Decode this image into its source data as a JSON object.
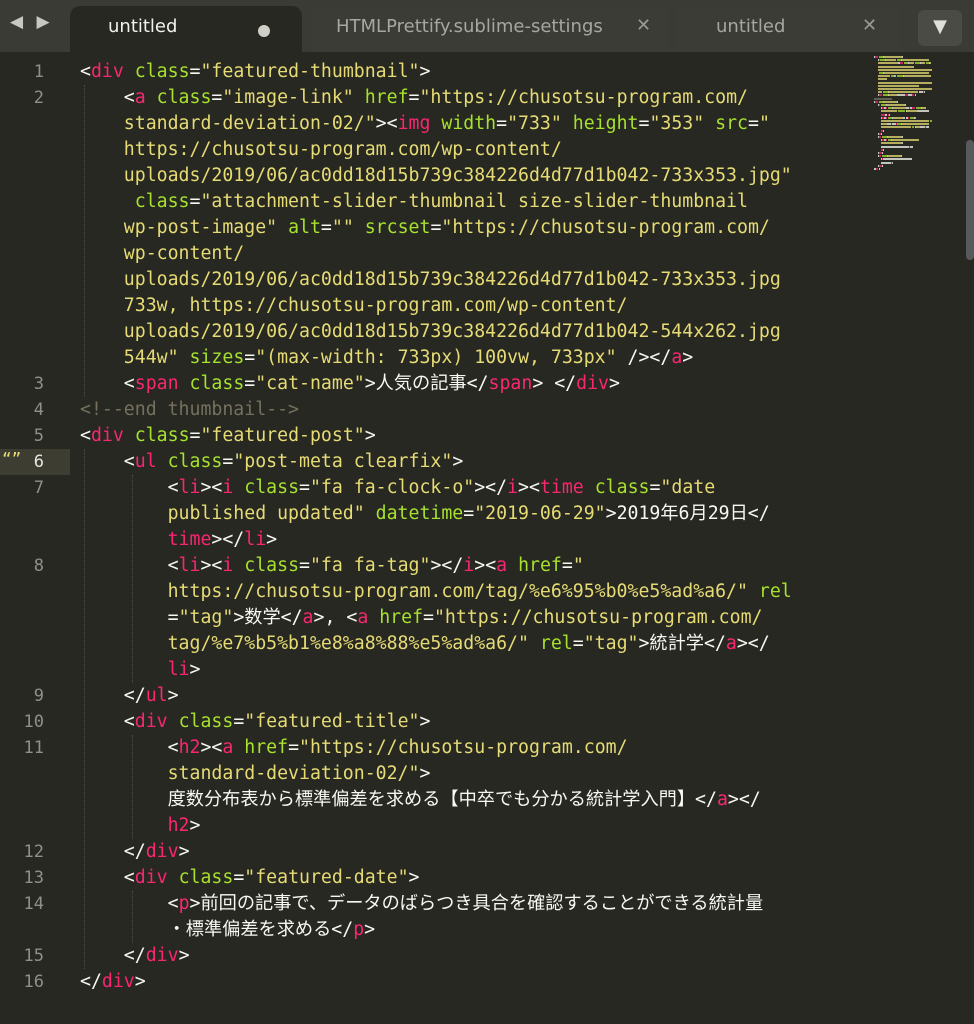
{
  "nav": {
    "arrows": "◀ ▶"
  },
  "tabs": [
    {
      "label": "untitled",
      "state": "modified",
      "active": true
    },
    {
      "label": "HTMLPrettify.sublime-settings",
      "close": "✕",
      "active": false
    },
    {
      "label": "untitled",
      "close": "✕",
      "active": false
    }
  ],
  "menu_arrow": "▼",
  "editor": {
    "current_line": 6,
    "bookmark_glyph": "“”",
    "line_numbers": [
      "1",
      "2",
      "3",
      "4",
      "5",
      "6",
      "7",
      "8",
      "9",
      "10",
      "11",
      "12",
      "13",
      "14",
      "15",
      "16"
    ]
  },
  "code": [
    [
      [
        "p",
        "<"
      ],
      [
        "t",
        "div"
      ],
      [
        "p",
        " "
      ],
      [
        "a",
        "class"
      ],
      [
        "p",
        "="
      ],
      [
        "s",
        "\"featured-thumbnail\""
      ],
      [
        "p",
        ">"
      ]
    ],
    [
      [
        "p",
        "    <"
      ],
      [
        "t",
        "a"
      ],
      [
        "p",
        " "
      ],
      [
        "a",
        "class"
      ],
      [
        "p",
        "="
      ],
      [
        "s",
        "\"image-link\""
      ],
      [
        "p",
        " "
      ],
      [
        "a",
        "href"
      ],
      [
        "p",
        "="
      ],
      [
        "s",
        "\"https://chusotsu-program.com/"
      ]
    ],
    [
      [
        "s",
        "    standard-deviation-02/\""
      ],
      [
        "p",
        "><"
      ],
      [
        "t",
        "img"
      ],
      [
        "p",
        " "
      ],
      [
        "a",
        "width"
      ],
      [
        "p",
        "="
      ],
      [
        "s",
        "\"733\""
      ],
      [
        "p",
        " "
      ],
      [
        "a",
        "height"
      ],
      [
        "p",
        "="
      ],
      [
        "s",
        "\"353\""
      ],
      [
        "p",
        " "
      ],
      [
        "a",
        "src"
      ],
      [
        "p",
        "="
      ],
      [
        "s",
        "\""
      ]
    ],
    [
      [
        "s",
        "    https://chusotsu-program.com/wp-content/"
      ]
    ],
    [
      [
        "s",
        "    uploads/2019/06/ac0dd18d15b739c384226d4d77d1b042-733x353.jpg\""
      ]
    ],
    [
      [
        "p",
        "     "
      ],
      [
        "a",
        "class"
      ],
      [
        "p",
        "="
      ],
      [
        "s",
        "\"attachment-slider-thumbnail size-slider-thumbnail"
      ]
    ],
    [
      [
        "s",
        "    wp-post-image\""
      ],
      [
        "p",
        " "
      ],
      [
        "a",
        "alt"
      ],
      [
        "p",
        "="
      ],
      [
        "s",
        "\"\""
      ],
      [
        "p",
        " "
      ],
      [
        "a",
        "srcset"
      ],
      [
        "p",
        "="
      ],
      [
        "s",
        "\"https://chusotsu-program.com/"
      ]
    ],
    [
      [
        "s",
        "    wp-content/"
      ]
    ],
    [
      [
        "s",
        "    uploads/2019/06/ac0dd18d15b739c384226d4d77d1b042-733x353.jpg"
      ]
    ],
    [
      [
        "s",
        "    733w, https://chusotsu-program.com/wp-content/"
      ]
    ],
    [
      [
        "s",
        "    uploads/2019/06/ac0dd18d15b739c384226d4d77d1b042-544x262.jpg"
      ]
    ],
    [
      [
        "s",
        "    544w\""
      ],
      [
        "p",
        " "
      ],
      [
        "a",
        "sizes"
      ],
      [
        "p",
        "="
      ],
      [
        "s",
        "\"(max-width: 733px) 100vw, 733px\""
      ],
      [
        "p",
        " /></"
      ],
      [
        "t",
        "a"
      ],
      [
        "p",
        ">"
      ]
    ],
    [
      [
        "p",
        "    <"
      ],
      [
        "t",
        "span"
      ],
      [
        "p",
        " "
      ],
      [
        "a",
        "class"
      ],
      [
        "p",
        "="
      ],
      [
        "s",
        "\"cat-name\""
      ],
      [
        "p",
        ">人気の記事</"
      ],
      [
        "t",
        "span"
      ],
      [
        "p",
        "> </"
      ],
      [
        "t",
        "div"
      ],
      [
        "p",
        ">"
      ]
    ],
    [
      [
        "c",
        "<!--end thumbnail-->"
      ]
    ],
    [
      [
        "p",
        "<"
      ],
      [
        "t",
        "div"
      ],
      [
        "p",
        " "
      ],
      [
        "a",
        "class"
      ],
      [
        "p",
        "="
      ],
      [
        "s",
        "\"featured-post\""
      ],
      [
        "p",
        ">"
      ]
    ],
    [
      [
        "p",
        "    <"
      ],
      [
        "t",
        "ul"
      ],
      [
        "p",
        " "
      ],
      [
        "a",
        "class"
      ],
      [
        "p",
        "="
      ],
      [
        "s",
        "\"post-meta clearfix\""
      ],
      [
        "p",
        ">"
      ]
    ],
    [
      [
        "p",
        "        <"
      ],
      [
        "t",
        "li"
      ],
      [
        "p",
        "><"
      ],
      [
        "t",
        "i"
      ],
      [
        "p",
        " "
      ],
      [
        "a",
        "class"
      ],
      [
        "p",
        "="
      ],
      [
        "s",
        "\"fa fa-clock-o\""
      ],
      [
        "p",
        "></"
      ],
      [
        "t",
        "i"
      ],
      [
        "p",
        "><"
      ],
      [
        "t",
        "time"
      ],
      [
        "p",
        " "
      ],
      [
        "a",
        "class"
      ],
      [
        "p",
        "="
      ],
      [
        "s",
        "\"date"
      ]
    ],
    [
      [
        "s",
        "        published updated\""
      ],
      [
        "p",
        " "
      ],
      [
        "a",
        "datetime"
      ],
      [
        "p",
        "="
      ],
      [
        "s",
        "\"2019-06-29\""
      ],
      [
        "p",
        ">2019年6月29日</"
      ]
    ],
    [
      [
        "t",
        "        time"
      ],
      [
        "p",
        "></"
      ],
      [
        "t",
        "li"
      ],
      [
        "p",
        ">"
      ]
    ],
    [
      [
        "p",
        "        <"
      ],
      [
        "t",
        "li"
      ],
      [
        "p",
        "><"
      ],
      [
        "t",
        "i"
      ],
      [
        "p",
        " "
      ],
      [
        "a",
        "class"
      ],
      [
        "p",
        "="
      ],
      [
        "s",
        "\"fa fa-tag\""
      ],
      [
        "p",
        "></"
      ],
      [
        "t",
        "i"
      ],
      [
        "p",
        "><"
      ],
      [
        "t",
        "a"
      ],
      [
        "p",
        " "
      ],
      [
        "a",
        "href"
      ],
      [
        "p",
        "="
      ],
      [
        "s",
        "\""
      ]
    ],
    [
      [
        "s",
        "        https://chusotsu-program.com/tag/%e6%95%b0%e5%ad%a6/\""
      ],
      [
        "p",
        " "
      ],
      [
        "a",
        "rel"
      ]
    ],
    [
      [
        "p",
        "        ="
      ],
      [
        "s",
        "\"tag\""
      ],
      [
        "p",
        ">数学</"
      ],
      [
        "t",
        "a"
      ],
      [
        "p",
        ">, <"
      ],
      [
        "t",
        "a"
      ],
      [
        "p",
        " "
      ],
      [
        "a",
        "href"
      ],
      [
        "p",
        "="
      ],
      [
        "s",
        "\"https://chusotsu-program.com/"
      ]
    ],
    [
      [
        "s",
        "        tag/%e7%b5%b1%e8%a8%88%e5%ad%a6/\""
      ],
      [
        "p",
        " "
      ],
      [
        "a",
        "rel"
      ],
      [
        "p",
        "="
      ],
      [
        "s",
        "\"tag\""
      ],
      [
        "p",
        ">統計学</"
      ],
      [
        "t",
        "a"
      ],
      [
        "p",
        "></"
      ]
    ],
    [
      [
        "t",
        "        li"
      ],
      [
        "p",
        ">"
      ]
    ],
    [
      [
        "p",
        "    </"
      ],
      [
        "t",
        "ul"
      ],
      [
        "p",
        ">"
      ]
    ],
    [
      [
        "p",
        "    <"
      ],
      [
        "t",
        "div"
      ],
      [
        "p",
        " "
      ],
      [
        "a",
        "class"
      ],
      [
        "p",
        "="
      ],
      [
        "s",
        "\"featured-title\""
      ],
      [
        "p",
        ">"
      ]
    ],
    [
      [
        "p",
        "        <"
      ],
      [
        "t",
        "h2"
      ],
      [
        "p",
        "><"
      ],
      [
        "t",
        "a"
      ],
      [
        "p",
        " "
      ],
      [
        "a",
        "href"
      ],
      [
        "p",
        "="
      ],
      [
        "s",
        "\"https://chusotsu-program.com/"
      ]
    ],
    [
      [
        "s",
        "        standard-deviation-02/\""
      ],
      [
        "p",
        ">"
      ]
    ],
    [
      [
        "p",
        "        度数分布表から標準偏差を求める【中卒でも分かる統計学入門】</"
      ],
      [
        "t",
        "a"
      ],
      [
        "p",
        "></"
      ]
    ],
    [
      [
        "t",
        "        h2"
      ],
      [
        "p",
        ">"
      ]
    ],
    [
      [
        "p",
        "    </"
      ],
      [
        "t",
        "div"
      ],
      [
        "p",
        ">"
      ]
    ],
    [
      [
        "p",
        "    <"
      ],
      [
        "t",
        "div"
      ],
      [
        "p",
        " "
      ],
      [
        "a",
        "class"
      ],
      [
        "p",
        "="
      ],
      [
        "s",
        "\"featured-date\""
      ],
      [
        "p",
        ">"
      ]
    ],
    [
      [
        "p",
        "        <"
      ],
      [
        "t",
        "p"
      ],
      [
        "p",
        ">前回の記事で、データのばらつき具合を確認することができる統計量"
      ]
    ],
    [
      [
        "p",
        "        ・標準偏差を求める</"
      ],
      [
        "t",
        "p"
      ],
      [
        "p",
        ">"
      ]
    ],
    [
      [
        "p",
        "    </"
      ],
      [
        "t",
        "div"
      ],
      [
        "p",
        ">"
      ]
    ],
    [
      [
        "p",
        "</"
      ],
      [
        "t",
        "div"
      ],
      [
        "p",
        ">"
      ]
    ]
  ],
  "colors": {
    "background": "#272822",
    "tag": "#f92672",
    "attr": "#a6e22e",
    "string": "#e6db74",
    "comment": "#75715e",
    "text": "#f8f8f2"
  }
}
